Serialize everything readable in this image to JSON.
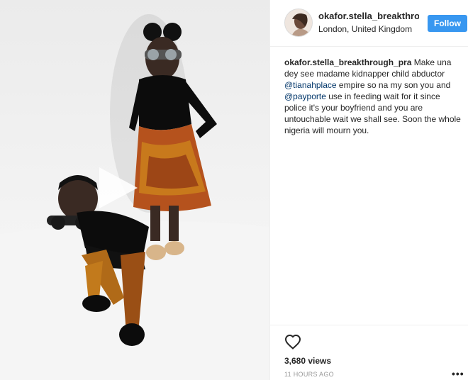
{
  "post": {
    "username": "okafor.stella_breakthrough",
    "location": "London, United Kingdom",
    "follow_label": "Follow"
  },
  "caption": {
    "username": "okafor.stella_breakthrough_pra",
    "text_1": " Make una dey see madame kidnapper child abductor ",
    "mention_1": "@tianahplace",
    "text_2": " empire so na my son you and ",
    "mention_2": "@payporte",
    "text_3": " use in feeding wait for it since police it's your boyfriend and you are untouchable wait we shall see. Soon the whole nigeria will mourn you."
  },
  "stats": {
    "views": "3,680 views",
    "time": "11 HOURS AGO"
  },
  "icons": {
    "like": "heart-icon",
    "more": "more-options-icon",
    "play": "play-icon"
  },
  "colors": {
    "accent": "#3897f0",
    "mention": "#003569",
    "timestamp": "#999999"
  }
}
